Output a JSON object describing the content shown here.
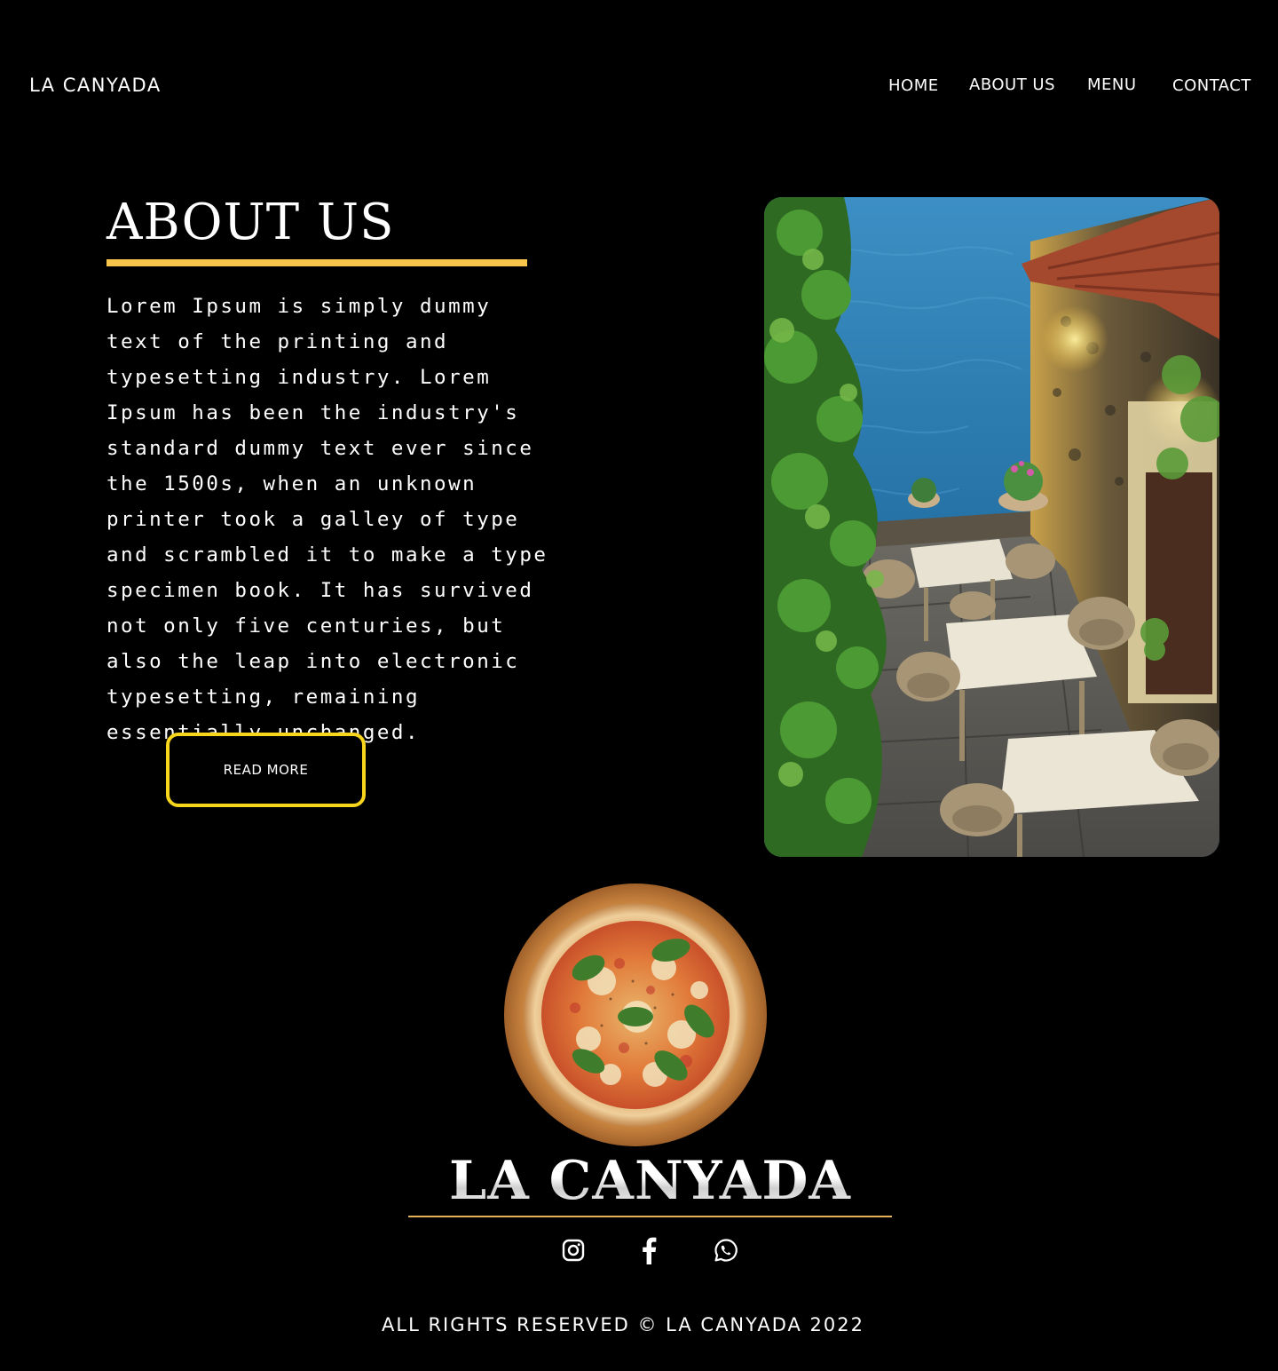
{
  "header": {
    "logo": "LA CANYADA",
    "nav": [
      "HOME",
      "ABOUT US",
      "MENU",
      "CONTACT"
    ]
  },
  "about": {
    "title": "ABOUT US",
    "body": "Lorem Ipsum is simply dummy text of the printing and typesetting industry. Lorem Ipsum has been the industry's standard dummy text ever since the 1500s, when an unknown printer took a galley of type and scrambled it to make a type specimen book. It has survived not only five centuries, but also the leap into electronic typesetting, remaining essentially unchanged.",
    "button_label": "READ MORE",
    "accent_color": "#f7c64a",
    "button_border_color": "#f7d51c"
  },
  "footer": {
    "brand": "LA CANYADA",
    "rule_color": "#e2b35a",
    "social_icons": [
      "instagram-icon",
      "facebook-icon",
      "whatsapp-icon"
    ],
    "copyright": "ALL RIGHTS RESERVED © LA CANYADA 2022"
  }
}
